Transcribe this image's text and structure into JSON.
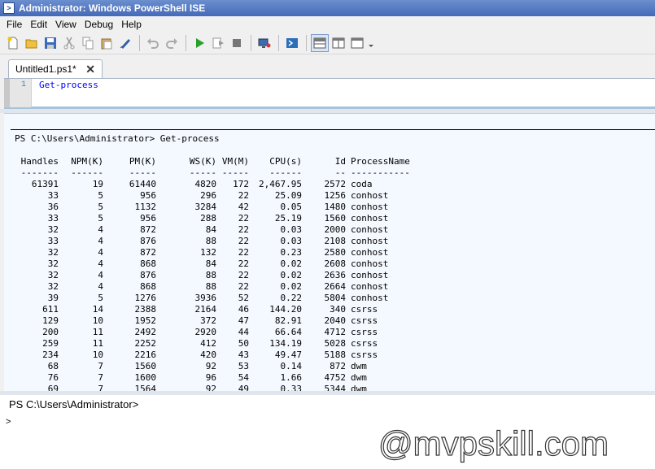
{
  "window": {
    "title": "Administrator: Windows PowerShell ISE"
  },
  "menu": [
    "File",
    "Edit",
    "View",
    "Debug",
    "Help"
  ],
  "toolbar": [
    "new-icon",
    "open-icon",
    "save-icon",
    "cut-icon",
    "copy-icon",
    "paste-icon",
    "run-selection-icon",
    "undo-icon",
    "redo-icon",
    "run-icon",
    "run-step-icon",
    "stop-icon",
    "remote-icon",
    "powershell-icon",
    "layout-top-icon",
    "layout-side-icon",
    "layout-max-icon"
  ],
  "tabs": [
    {
      "label": "Untitled1.ps1*",
      "close": "✕"
    }
  ],
  "editor": {
    "line_number": "1",
    "code": "Get-process"
  },
  "output": {
    "command": "PS C:\\Users\\Administrator> Get-process",
    "headers": [
      "Handles",
      "NPM(K)",
      "PM(K)",
      "WS(K)",
      "VM(M)",
      "CPU(s)",
      "Id",
      "ProcessName"
    ],
    "dashes": [
      "-------",
      "------",
      "-----",
      "-----",
      "-----",
      "------",
      "--",
      "-----------"
    ],
    "rows": [
      [
        "61391",
        "19",
        "61440",
        "4820",
        "172",
        "2,467.95",
        "2572",
        "coda"
      ],
      [
        "33",
        "5",
        "956",
        "296",
        "22",
        "25.09",
        "1256",
        "conhost"
      ],
      [
        "36",
        "5",
        "1132",
        "3284",
        "42",
        "0.05",
        "1480",
        "conhost"
      ],
      [
        "33",
        "5",
        "956",
        "288",
        "22",
        "25.19",
        "1560",
        "conhost"
      ],
      [
        "32",
        "4",
        "872",
        "84",
        "22",
        "0.03",
        "2000",
        "conhost"
      ],
      [
        "33",
        "4",
        "876",
        "88",
        "22",
        "0.03",
        "2108",
        "conhost"
      ],
      [
        "32",
        "4",
        "872",
        "132",
        "22",
        "0.23",
        "2580",
        "conhost"
      ],
      [
        "32",
        "4",
        "868",
        "84",
        "22",
        "0.02",
        "2608",
        "conhost"
      ],
      [
        "32",
        "4",
        "876",
        "88",
        "22",
        "0.02",
        "2636",
        "conhost"
      ],
      [
        "32",
        "4",
        "868",
        "88",
        "22",
        "0.02",
        "2664",
        "conhost"
      ],
      [
        "39",
        "5",
        "1276",
        "3936",
        "52",
        "0.22",
        "5804",
        "conhost"
      ],
      [
        "611",
        "14",
        "2388",
        "2164",
        "46",
        "144.20",
        "340",
        "csrss"
      ],
      [
        "129",
        "10",
        "1952",
        "372",
        "47",
        "82.91",
        "2040",
        "csrss"
      ],
      [
        "200",
        "11",
        "2492",
        "2920",
        "44",
        "66.64",
        "4712",
        "csrss"
      ],
      [
        "259",
        "11",
        "2252",
        "412",
        "50",
        "134.19",
        "5028",
        "csrss"
      ],
      [
        "234",
        "10",
        "2216",
        "420",
        "43",
        "49.47",
        "5188",
        "csrss"
      ],
      [
        "68",
        "7",
        "1560",
        "92",
        "53",
        "0.14",
        "872",
        "dwm"
      ],
      [
        "76",
        "7",
        "1600",
        "96",
        "54",
        "1.66",
        "4752",
        "dwm"
      ],
      [
        "69",
        "7",
        "1564",
        "92",
        "49",
        "0.33",
        "5344",
        "dwm"
      ]
    ]
  },
  "console": {
    "prompt": "PS C:\\Users\\Administrator>",
    "caret": ">"
  },
  "watermark": "@mvpskill.com"
}
